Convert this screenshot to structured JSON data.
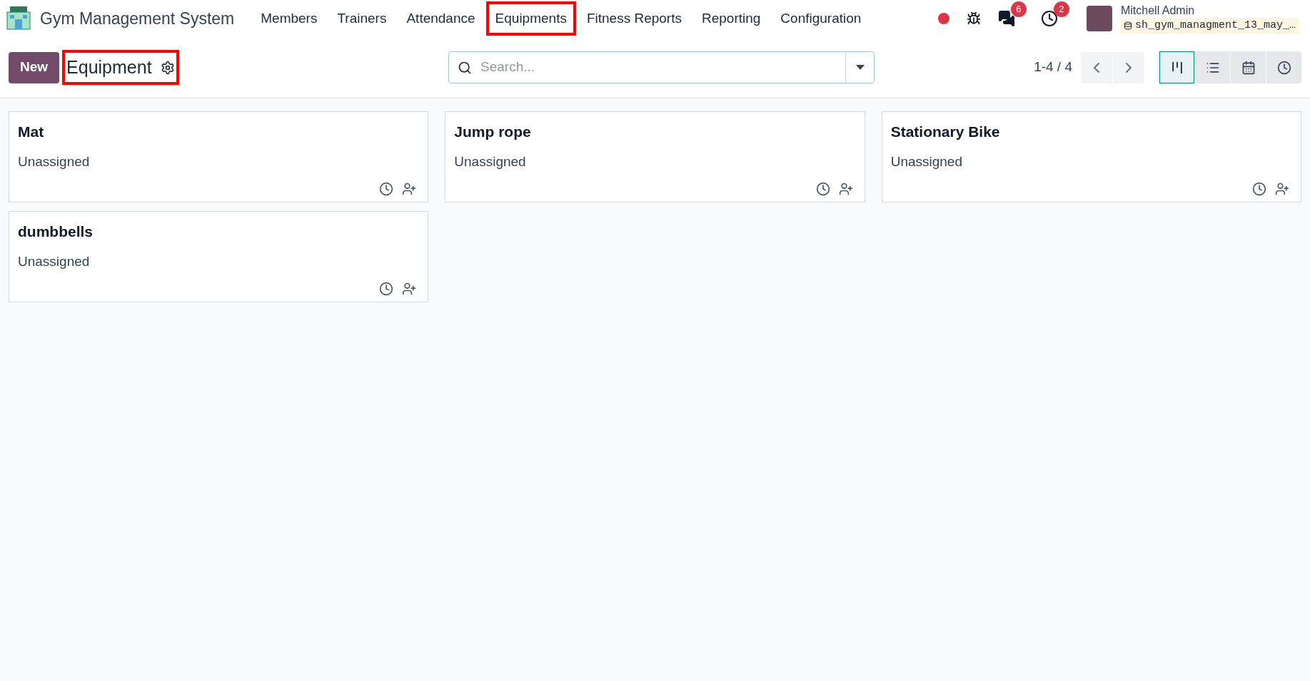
{
  "navbar": {
    "app_name": "Gym Management System",
    "menu": [
      {
        "label": "Members",
        "highlighted": false
      },
      {
        "label": "Trainers",
        "highlighted": false
      },
      {
        "label": "Attendance",
        "highlighted": false
      },
      {
        "label": "Equipments",
        "highlighted": true
      },
      {
        "label": "Fitness Reports",
        "highlighted": false
      },
      {
        "label": "Reporting",
        "highlighted": false
      },
      {
        "label": "Configuration",
        "highlighted": false
      }
    ],
    "messages_badge": "6",
    "activities_badge": "2",
    "user": {
      "name": "Mitchell Admin",
      "database": "sh_gym_managment_13_may_…"
    }
  },
  "control_panel": {
    "new_button": "New",
    "title": "Equipment",
    "title_highlighted": true,
    "search": {
      "placeholder": "Search..."
    },
    "pager": "1-4 / 4",
    "views": [
      {
        "kind": "kanban",
        "selected": true
      },
      {
        "kind": "list",
        "selected": false
      },
      {
        "kind": "calendar",
        "selected": false
      },
      {
        "kind": "activity",
        "selected": false
      }
    ]
  },
  "cards": [
    {
      "title": "Mat",
      "status": "Unassigned"
    },
    {
      "title": "Jump rope",
      "status": "Unassigned"
    },
    {
      "title": "Stationary Bike",
      "status": "Unassigned"
    },
    {
      "title": "dumbbells",
      "status": "Unassigned"
    }
  ]
}
